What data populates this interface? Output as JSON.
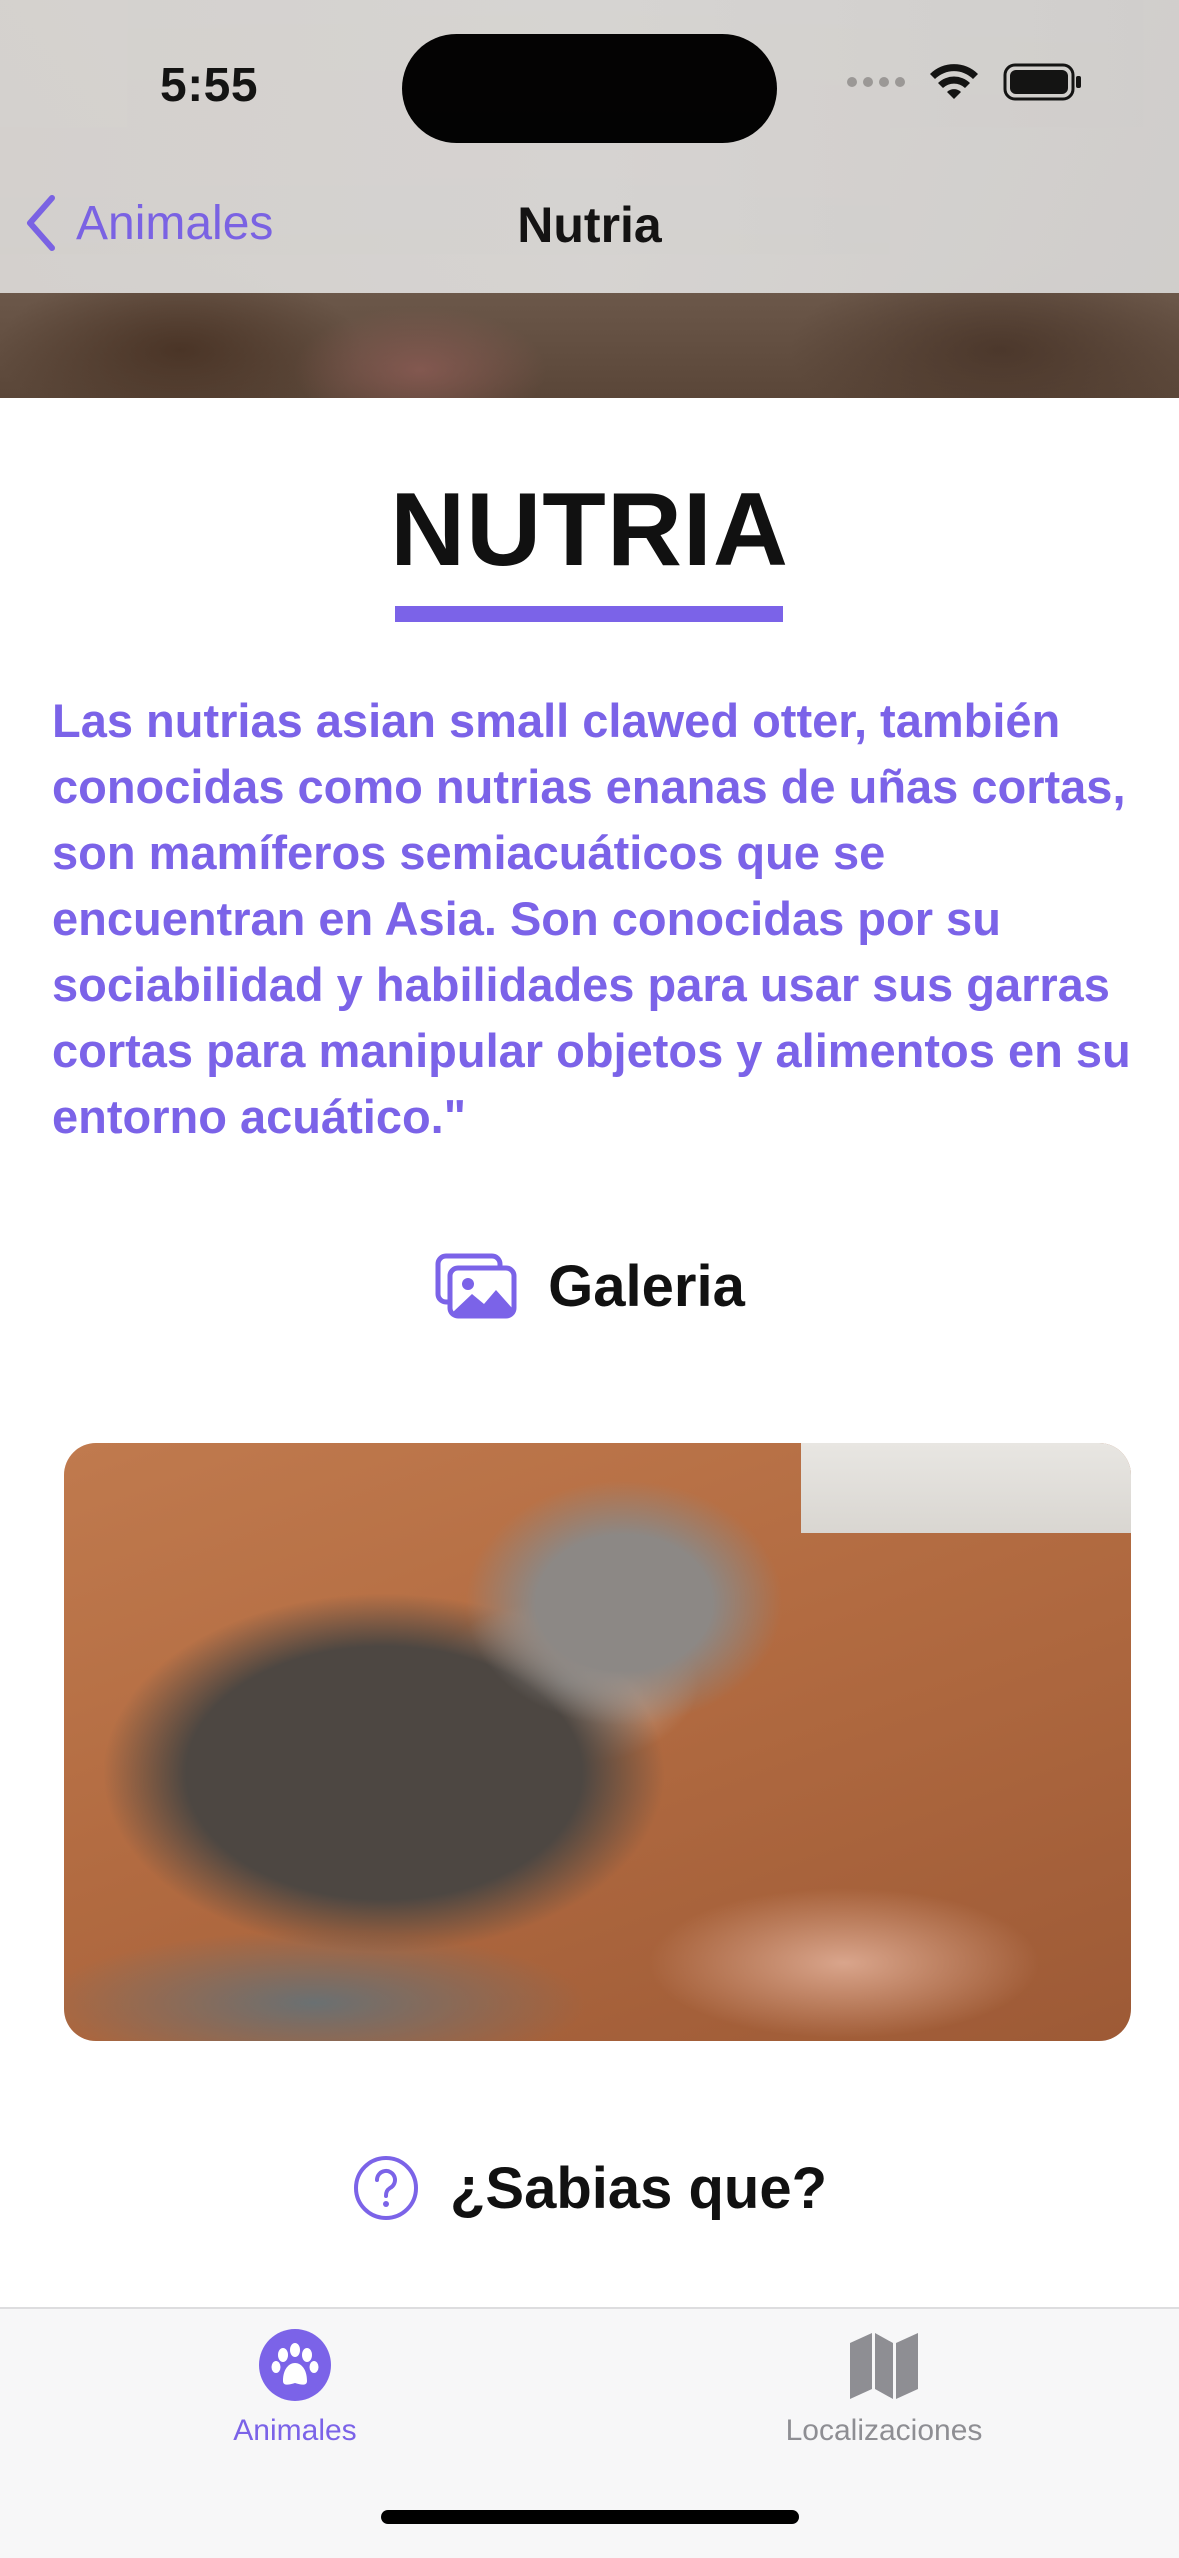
{
  "status_bar": {
    "time": "5:55"
  },
  "nav": {
    "back_label": "Animales",
    "title": "Nutria"
  },
  "content": {
    "heading": "NUTRIA",
    "description": "Las nutrias asian small clawed otter, también conocidas como nutrias enanas de uñas cortas, son mamíferos semiacuáticos que se encuentran en Asia. Son conocidas por su sociabilidad y habilidades para usar sus garras cortas para manipular objetos y alimentos en su entorno acuático.\"",
    "gallery_title": "Galeria",
    "trivia_title": "¿Sabias que?"
  },
  "tabbar": {
    "tabs": [
      {
        "label": "Animales",
        "icon": "paw-icon",
        "selected": true
      },
      {
        "label": "Localizaciones",
        "icon": "map-icon",
        "selected": false
      }
    ]
  },
  "colors": {
    "accent": "#7b63e8",
    "inactive_tab": "#8e8e93"
  }
}
